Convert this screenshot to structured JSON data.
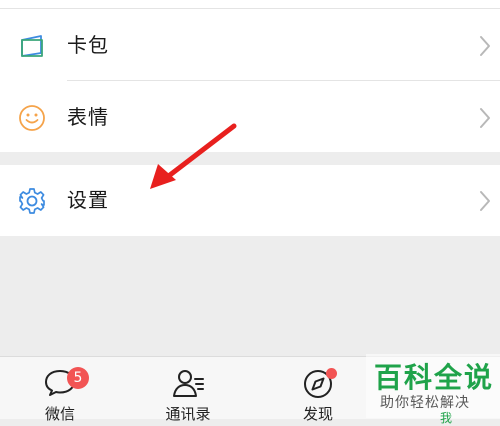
{
  "menu": {
    "items": [
      {
        "label": "卡包",
        "icon": "card-wallet-icon"
      },
      {
        "label": "表情",
        "icon": "smiley-face-icon"
      }
    ],
    "settings": {
      "label": "设置",
      "icon": "gear-icon"
    }
  },
  "tabbar": {
    "tabs": [
      {
        "label": "微信",
        "icon": "chat-bubble-icon",
        "badge": "5"
      },
      {
        "label": "通讯录",
        "icon": "contacts-icon"
      },
      {
        "label": "发现",
        "icon": "compass-icon",
        "dot": true
      },
      {
        "label": "我",
        "icon": "me-icon"
      }
    ]
  },
  "watermark": {
    "title": "百科全说",
    "subtitle": "助你轻松解决"
  },
  "colors": {
    "background": "#ededed",
    "accent_green": "#1fa34a",
    "badge_red": "#f25454",
    "arrow_red": "#e8201e",
    "icon_blue": "#3d8be0",
    "icon_orange": "#f5a34a"
  }
}
